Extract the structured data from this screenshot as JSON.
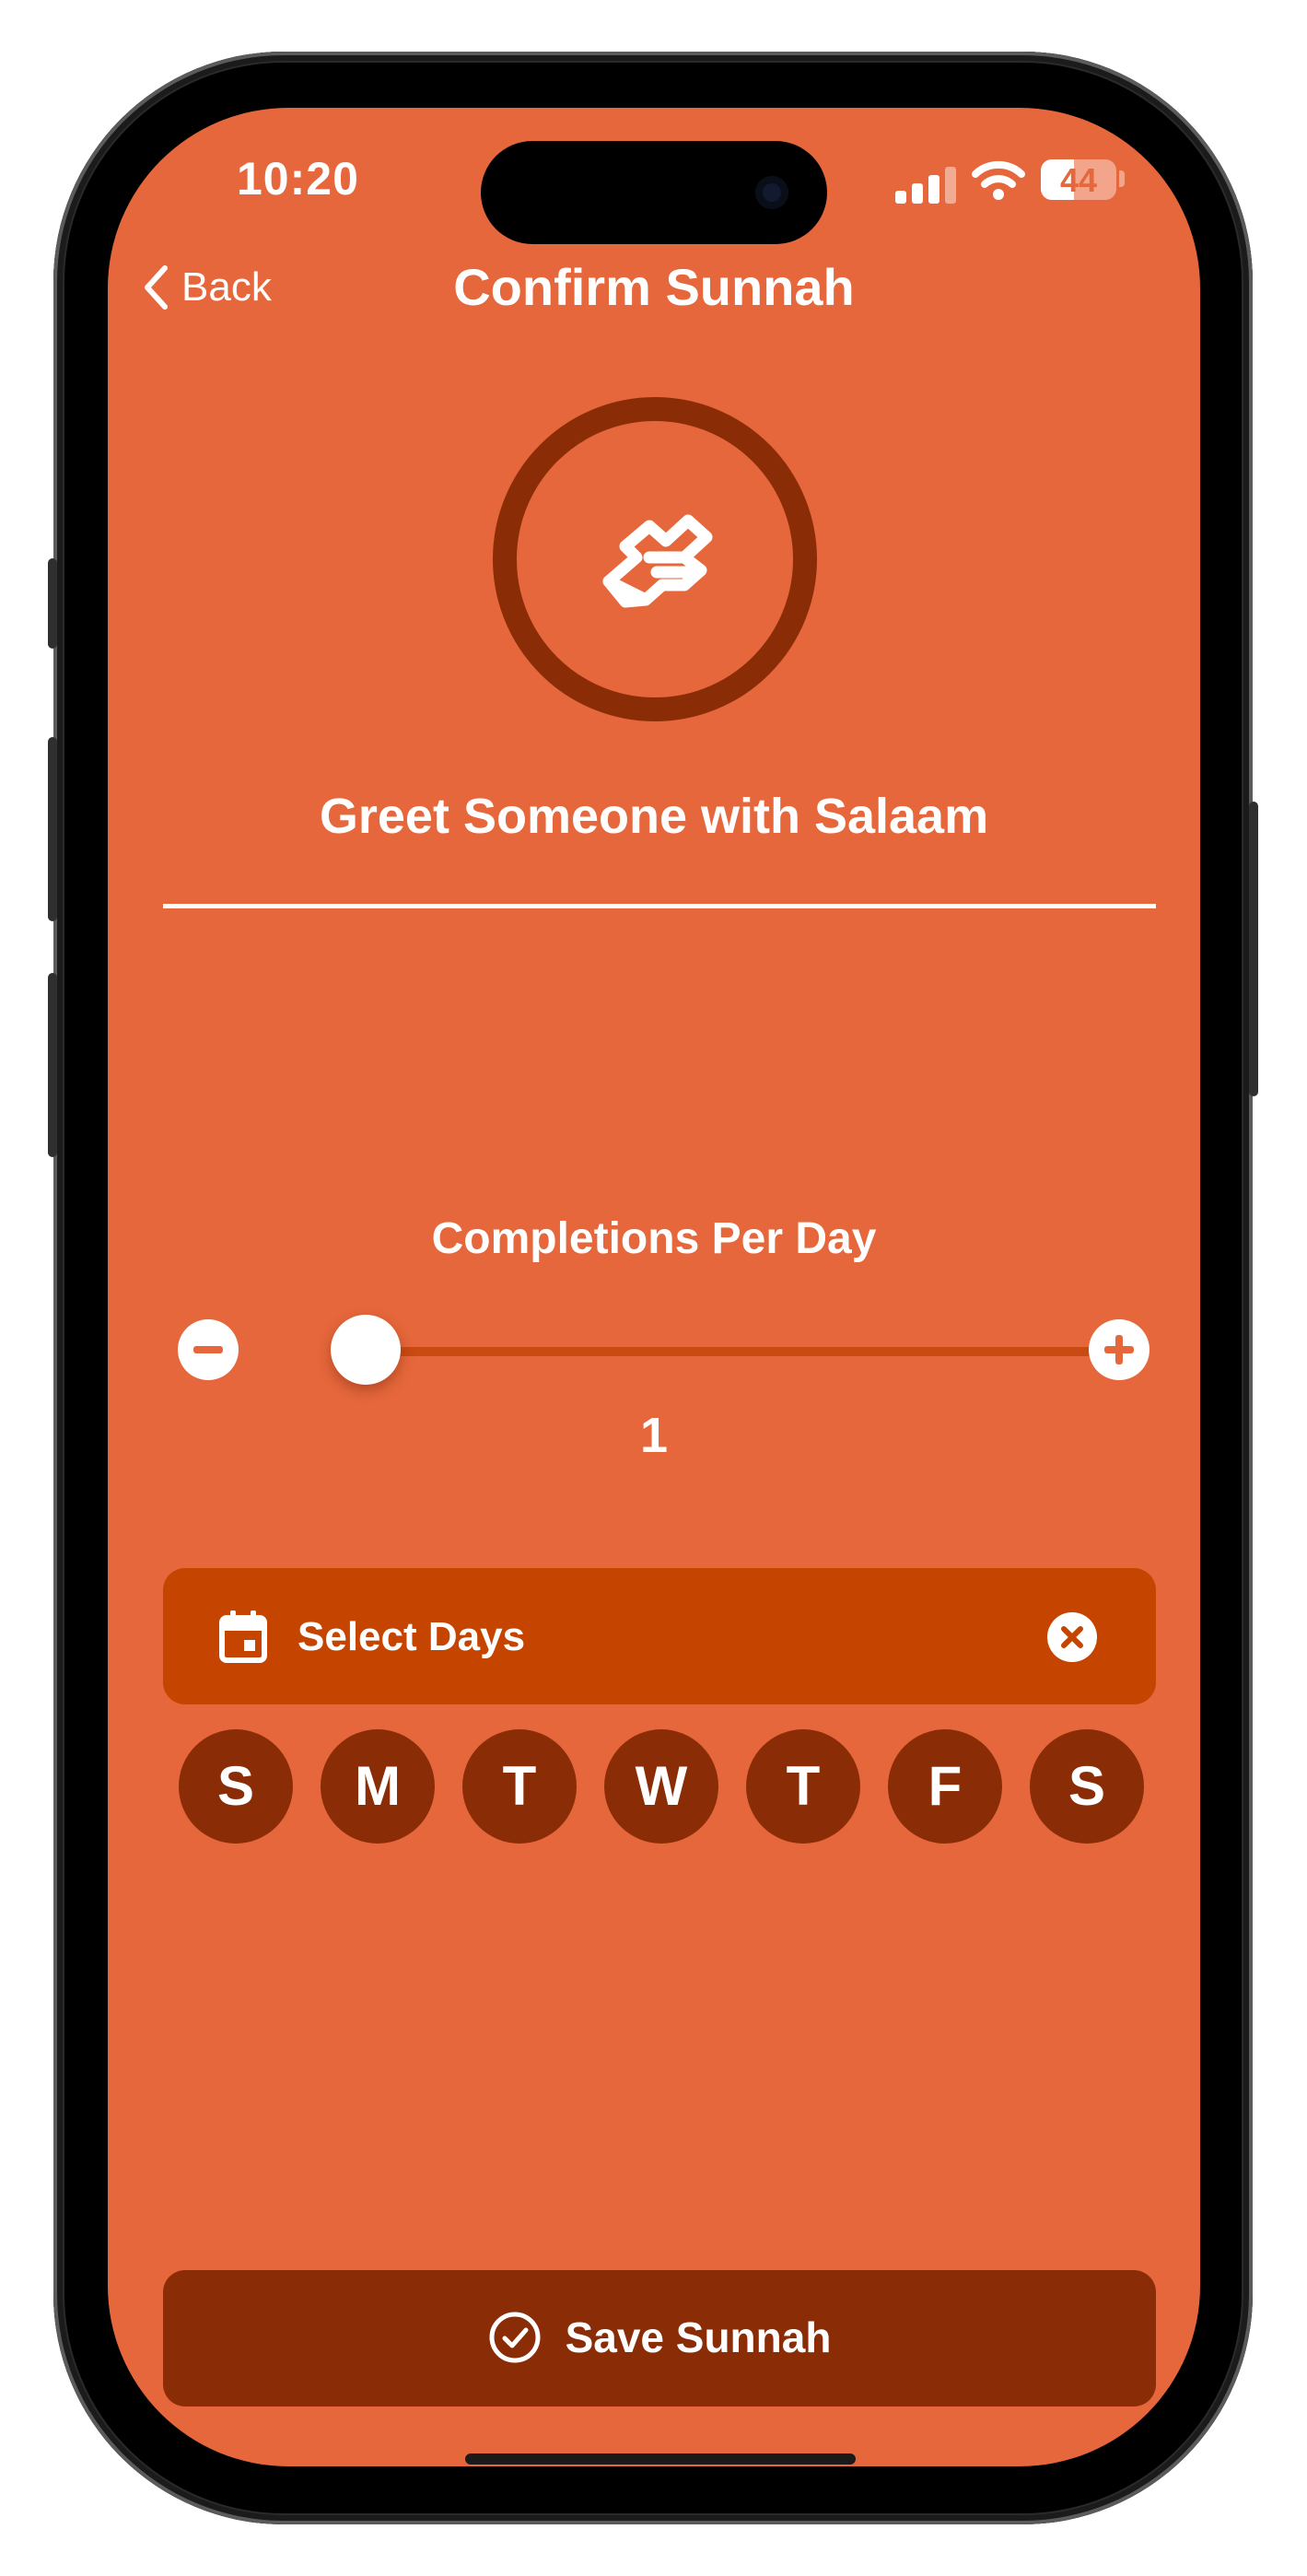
{
  "status_bar": {
    "time": "10:20",
    "battery_level": "44",
    "battery_fraction": 0.44
  },
  "nav": {
    "back_label": "Back",
    "title": "Confirm Sunnah"
  },
  "habit": {
    "icon": "handshake-icon",
    "title": "Greet Someone with Salaam"
  },
  "completions": {
    "label": "Completions Per Day",
    "value": "1",
    "slider_fraction": 0.0
  },
  "days": {
    "label": "Select Days",
    "items": [
      "S",
      "M",
      "T",
      "W",
      "T",
      "F",
      "S"
    ]
  },
  "save": {
    "label": "Save Sunnah"
  },
  "colors": {
    "background": "#e6673b",
    "accent_dark": "#8a2d06",
    "accent_mid": "#c54500",
    "text": "#ffffff"
  }
}
